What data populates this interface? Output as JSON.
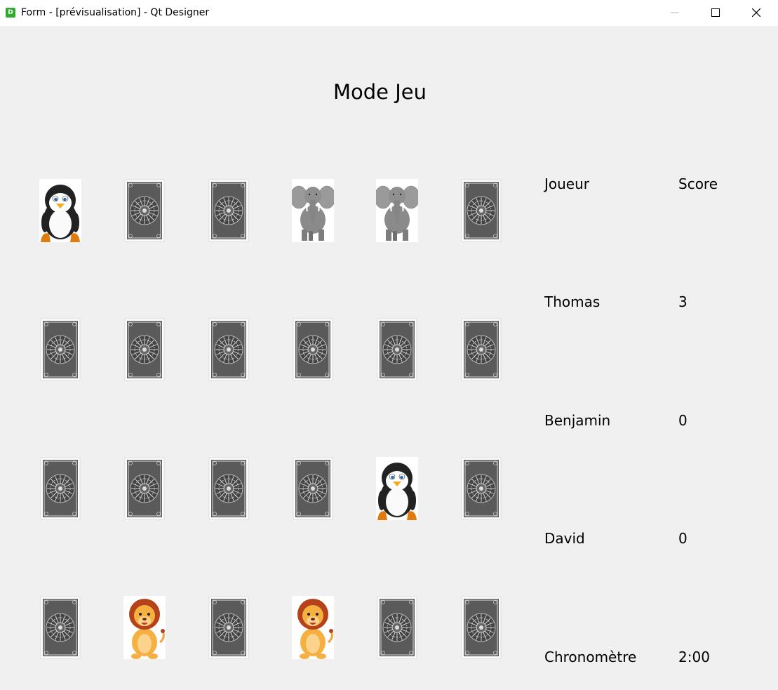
{
  "window": {
    "title": "Form - [prévisualisation] - Qt Designer",
    "app_icon_letter": "D"
  },
  "page": {
    "title": "Mode Jeu"
  },
  "scoreboard": {
    "header_player": "Joueur",
    "header_score": "Score",
    "players": [
      {
        "name": "Thomas",
        "score": "3"
      },
      {
        "name": "Benjamin",
        "score": "0"
      },
      {
        "name": "David",
        "score": "0"
      }
    ],
    "timer_label": "Chronomètre",
    "timer_value": "2:00"
  },
  "board": {
    "rows": [
      [
        "penguin",
        "back",
        "back",
        "elephant",
        "elephant",
        "back"
      ],
      [
        "back",
        "back",
        "back",
        "back",
        "back",
        "back"
      ],
      [
        "back",
        "back",
        "back",
        "back",
        "penguin",
        "back"
      ],
      [
        "back",
        "lion",
        "back",
        "lion",
        "back",
        "back"
      ]
    ]
  }
}
